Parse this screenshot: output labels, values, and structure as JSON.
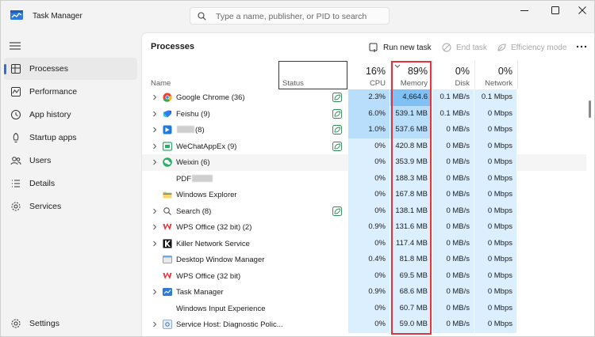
{
  "window": {
    "title": "Task Manager"
  },
  "search": {
    "placeholder": "Type a name, publisher, or PID to search"
  },
  "sidebar": {
    "items": [
      {
        "label": "Processes",
        "icon": "processes-icon",
        "active": true
      },
      {
        "label": "Performance",
        "icon": "performance-icon",
        "active": false
      },
      {
        "label": "App history",
        "icon": "app-history-icon",
        "active": false
      },
      {
        "label": "Startup apps",
        "icon": "startup-apps-icon",
        "active": false
      },
      {
        "label": "Users",
        "icon": "users-icon",
        "active": false
      },
      {
        "label": "Details",
        "icon": "details-icon",
        "active": false
      },
      {
        "label": "Services",
        "icon": "services-icon",
        "active": false
      }
    ],
    "settings_label": "Settings"
  },
  "main": {
    "title": "Processes",
    "toolbar": {
      "run_new_task": "Run new task",
      "end_task": "End task",
      "efficiency_mode": "Efficiency mode"
    },
    "columns": {
      "name": "Name",
      "status": "Status",
      "cpu": {
        "percent": "16%",
        "label": "CPU"
      },
      "memory": {
        "percent": "89%",
        "label": "Memory"
      },
      "disk": {
        "percent": "0%",
        "label": "Disk"
      },
      "network": {
        "percent": "0%",
        "label": "Network"
      }
    },
    "rows": [
      {
        "name": "Google Chrome (36)",
        "expandable": true,
        "icon": "chrome-icon",
        "efficiency": true,
        "cpu": "2.3%",
        "memory": "4,664.6 MB",
        "disk": "0.1 MB/s",
        "network": "0.1 Mbps",
        "cpu_level": 2,
        "mem_level": 3
      },
      {
        "name": "Feishu (9)",
        "expandable": true,
        "icon": "feishu-icon",
        "efficiency": true,
        "cpu": "6.0%",
        "memory": "539.1 MB",
        "disk": "0.1 MB/s",
        "network": "0 Mbps",
        "cpu_level": 2,
        "mem_level": 2
      },
      {
        "name_suffix": "(8)",
        "blurred": true,
        "expandable": true,
        "icon": "app-blue-icon",
        "efficiency": true,
        "cpu": "1.0%",
        "memory": "537.6 MB",
        "disk": "0 MB/s",
        "network": "0 Mbps",
        "cpu_level": 2,
        "mem_level": 2
      },
      {
        "name": "WeChatAppEx (9)",
        "expandable": true,
        "icon": "wechatappex-icon",
        "efficiency": true,
        "cpu": "0%",
        "memory": "420.8 MB",
        "disk": "0 MB/s",
        "network": "0 Mbps",
        "cpu_level": 1,
        "mem_level": 1
      },
      {
        "name": "Weixin (6)",
        "expandable": true,
        "icon": "weixin-icon",
        "efficiency": false,
        "cpu": "0%",
        "memory": "353.9 MB",
        "disk": "0 MB/s",
        "network": "0 Mbps",
        "cpu_level": 1,
        "mem_level": 1,
        "highlight": true
      },
      {
        "name": "PDF",
        "blurred_after": true,
        "expandable": false,
        "icon": "pdf-icon",
        "efficiency": false,
        "cpu": "0%",
        "memory": "188.3 MB",
        "disk": "0 MB/s",
        "network": "0 Mbps",
        "cpu_level": 1,
        "mem_level": 1
      },
      {
        "name": "Windows Explorer",
        "expandable": false,
        "icon": "folder-icon",
        "efficiency": false,
        "cpu": "0%",
        "memory": "167.8 MB",
        "disk": "0 MB/s",
        "network": "0 Mbps",
        "cpu_level": 1,
        "mem_level": 1
      },
      {
        "name": "Search (8)",
        "expandable": true,
        "icon": "search-process-icon",
        "efficiency": true,
        "cpu": "0%",
        "memory": "138.1 MB",
        "disk": "0 MB/s",
        "network": "0 Mbps",
        "cpu_level": 1,
        "mem_level": 1
      },
      {
        "name": "WPS Office (32 bit) (2)",
        "expandable": true,
        "icon": "wps-icon",
        "efficiency": false,
        "cpu": "0.9%",
        "memory": "131.6 MB",
        "disk": "0 MB/s",
        "network": "0 Mbps",
        "cpu_level": 1,
        "mem_level": 1
      },
      {
        "name": "Killer Network Service",
        "expandable": true,
        "icon": "killer-icon",
        "efficiency": false,
        "cpu": "0%",
        "memory": "117.4 MB",
        "disk": "0 MB/s",
        "network": "0 Mbps",
        "cpu_level": 1,
        "mem_level": 1
      },
      {
        "name": "Desktop Window Manager",
        "expandable": false,
        "icon": "dwm-icon",
        "efficiency": false,
        "cpu": "0.4%",
        "memory": "81.8 MB",
        "disk": "0 MB/s",
        "network": "0 Mbps",
        "cpu_level": 1,
        "mem_level": 1
      },
      {
        "name": "WPS Office (32 bit)",
        "expandable": false,
        "icon": "wps-icon",
        "efficiency": false,
        "cpu": "0%",
        "memory": "69.5 MB",
        "disk": "0 MB/s",
        "network": "0 Mbps",
        "cpu_level": 1,
        "mem_level": 1
      },
      {
        "name": "Task Manager",
        "expandable": true,
        "icon": "task-manager-icon",
        "efficiency": false,
        "cpu": "0.9%",
        "memory": "68.6 MB",
        "disk": "0 MB/s",
        "network": "0 Mbps",
        "cpu_level": 1,
        "mem_level": 1
      },
      {
        "name": "Windows Input Experience",
        "expandable": false,
        "icon": "none",
        "efficiency": false,
        "cpu": "0%",
        "memory": "60.7 MB",
        "disk": "0 MB/s",
        "network": "0 Mbps",
        "cpu_level": 1,
        "mem_level": 1
      },
      {
        "name": "Service Host: Diagnostic Polic...",
        "expandable": true,
        "icon": "service-host-icon",
        "efficiency": false,
        "cpu": "0%",
        "memory": "59.0 MB",
        "disk": "0 MB/s",
        "network": "0 Mbps",
        "cpu_level": 1,
        "mem_level": 1
      }
    ]
  },
  "colors": {
    "heat_1": "#dcefff",
    "heat_2": "#b9defc",
    "heat_3": "#7fc1f5",
    "accent": "#2e6ed6",
    "highlight_frame": "#e8323a"
  }
}
